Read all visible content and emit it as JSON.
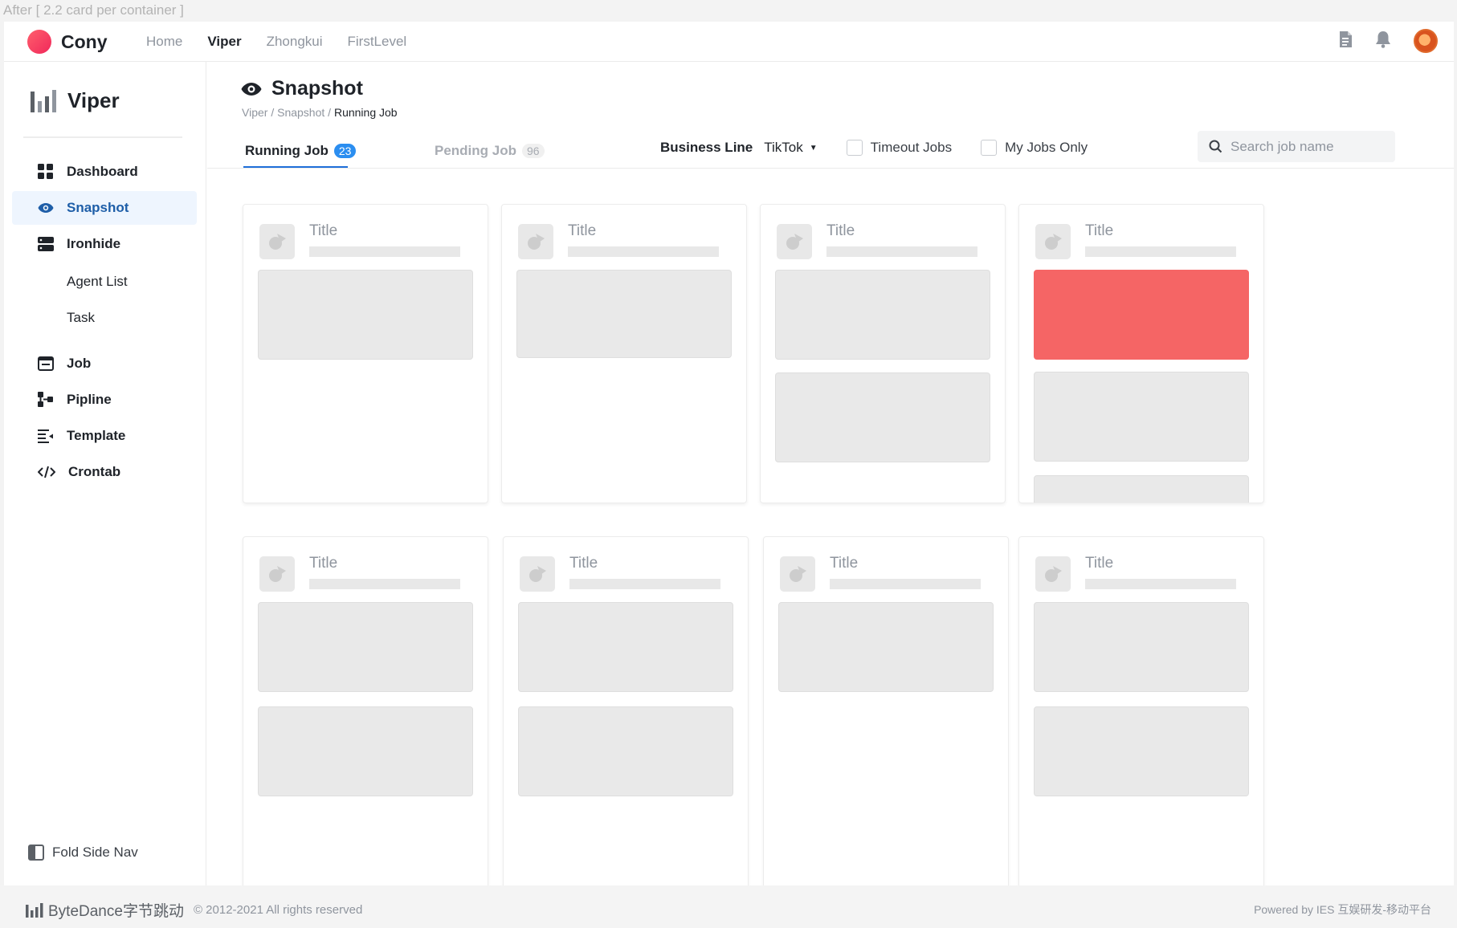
{
  "caption": "After [ 2.2 card per container ]",
  "topnav": {
    "brand": "Cony",
    "links": [
      "Home",
      "Viper",
      "Zhongkui",
      "FirstLevel"
    ],
    "active_link": "Viper",
    "icons": [
      "document-icon",
      "bell-icon",
      "avatar"
    ]
  },
  "sidebar": {
    "title": "Viper",
    "items": [
      {
        "label": "Dashboard",
        "icon": "dashboard-icon"
      },
      {
        "label": "Snapshot",
        "icon": "eye-icon",
        "active": true
      },
      {
        "label": "Ironhide",
        "icon": "server-icon"
      },
      {
        "label": "Agent List"
      },
      {
        "label": "Task"
      },
      {
        "label": "Job",
        "icon": "job-icon"
      },
      {
        "label": "Pipline",
        "icon": "pipeline-icon"
      },
      {
        "label": "Template",
        "icon": "template-icon"
      },
      {
        "label": "Crontab",
        "icon": "code-icon"
      }
    ],
    "fold_label": "Fold Side Nav"
  },
  "page": {
    "title": "Snapshot",
    "breadcrumb": [
      "Viper",
      "Snapshot",
      "Running Job"
    ],
    "breadcrumb_sep": "/",
    "tabs": [
      {
        "label": "Running Job",
        "count": "23",
        "active": true
      },
      {
        "label": "Pending Job",
        "count": "96",
        "active": false
      }
    ],
    "filters": {
      "business_line_label": "Business Line",
      "business_line_value": "TikTok",
      "timeout_jobs_label": "Timeout Jobs",
      "my_jobs_label": "My Jobs Only",
      "search_placeholder": "Search job name"
    }
  },
  "cards": [
    {
      "title": "Title"
    },
    {
      "title": "Title"
    },
    {
      "title": "Title"
    },
    {
      "title": "Title"
    },
    {
      "title": "Title"
    },
    {
      "title": "Title"
    },
    {
      "title": "Title"
    },
    {
      "title": "Title"
    }
  ],
  "colors": {
    "accent_blue": "#1e6fd9",
    "badge_blue": "#2b8ef0",
    "highlight_red": "#f56565",
    "brand_gradient_start": "#ff5f6d",
    "brand_gradient_end": "#f0285a"
  },
  "footer": {
    "brand": "ByteDance字节跳动",
    "copyright": "© 2012-2021 All rights reserved",
    "powered": "Powered by IES 互娱研发-移动平台"
  }
}
